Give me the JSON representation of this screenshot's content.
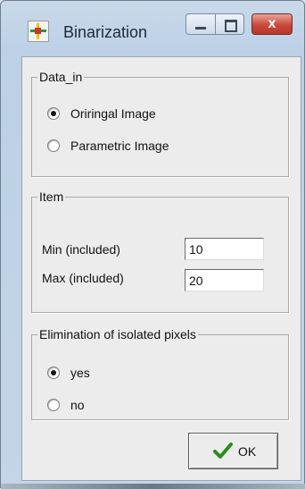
{
  "window": {
    "title": "Binarization",
    "minimize_icon": "minimize-icon",
    "maximize_icon": "maximize-icon",
    "close_label": "x"
  },
  "data_in": {
    "legend": "Data_in",
    "options": [
      {
        "label": "Oriringal Image",
        "checked": true
      },
      {
        "label": "Parametric Image",
        "checked": false
      }
    ]
  },
  "item": {
    "legend": "Item",
    "min_label": "Min (included)",
    "min_value": "10",
    "max_label": "Max (included)",
    "max_value": "20"
  },
  "elimination": {
    "legend": "Elimination of isolated pixels",
    "options": [
      {
        "label": "yes",
        "checked": true
      },
      {
        "label": "no",
        "checked": false
      }
    ]
  },
  "ok_button": {
    "label": "OK",
    "icon": "checkmark-icon",
    "icon_color": "#2e8b1e"
  },
  "colors": {
    "titlebar": "#bcd0e6",
    "client": "#ececec",
    "close_button": "#c9493a"
  }
}
